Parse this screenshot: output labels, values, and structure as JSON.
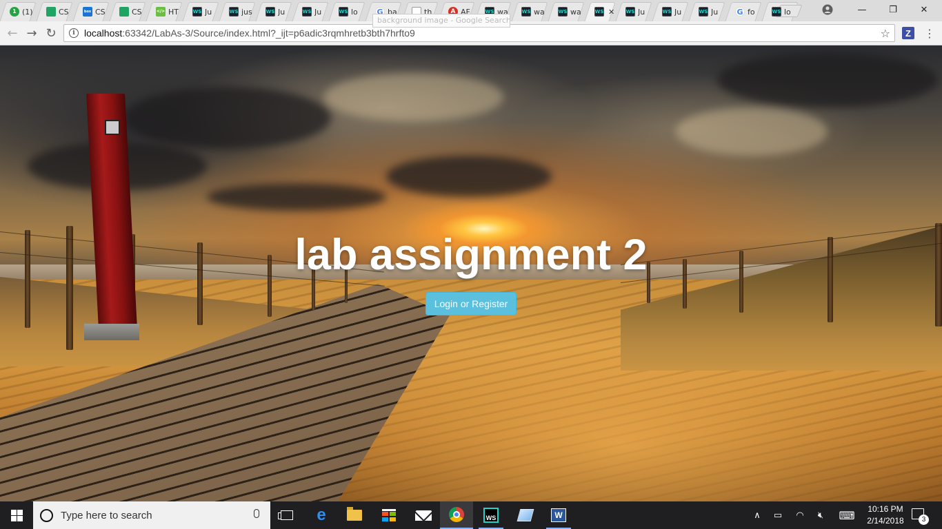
{
  "browser": {
    "tabs": [
      {
        "favicon": "circle-one-icon",
        "favicon_text": "1",
        "label": "(1)"
      },
      {
        "favicon": "sheets-icon",
        "favicon_text": "",
        "label": "CS"
      },
      {
        "favicon": "box-icon",
        "favicon_text": "box",
        "label": "CS"
      },
      {
        "favicon": "sheets-icon",
        "favicon_text": "",
        "label": "CS"
      },
      {
        "favicon": "html-icon",
        "favicon_text": "</>",
        "label": "HT"
      },
      {
        "favicon": "webstorm-icon",
        "favicon_text": "WS",
        "label": "Ju"
      },
      {
        "favicon": "webstorm-icon",
        "favicon_text": "WS",
        "label": "jus"
      },
      {
        "favicon": "webstorm-icon",
        "favicon_text": "WS",
        "label": "Ju"
      },
      {
        "favicon": "webstorm-icon",
        "favicon_text": "WS",
        "label": "Ju"
      },
      {
        "favicon": "webstorm-icon",
        "favicon_text": "WS",
        "label": "lo"
      },
      {
        "favicon": "google-icon",
        "favicon_text": "G",
        "label": "ba"
      },
      {
        "favicon": "document-icon",
        "favicon_text": "",
        "label": "th"
      },
      {
        "favicon": "ab-icon",
        "favicon_text": "A",
        "label": "AF"
      },
      {
        "favicon": "webstorm-icon",
        "favicon_text": "WS",
        "label": "wa"
      },
      {
        "favicon": "webstorm-icon",
        "favicon_text": "WS",
        "label": "wa"
      },
      {
        "favicon": "webstorm-icon",
        "favicon_text": "WS",
        "label": "wa"
      },
      {
        "favicon": "webstorm-icon",
        "favicon_text": "WS",
        "label": "",
        "active": true
      },
      {
        "favicon": "webstorm-icon",
        "favicon_text": "WS",
        "label": "Ju"
      },
      {
        "favicon": "webstorm-icon",
        "favicon_text": "WS",
        "label": "Ju"
      },
      {
        "favicon": "webstorm-icon",
        "favicon_text": "WS",
        "label": "Ju"
      },
      {
        "favicon": "google-icon",
        "favicon_text": "G",
        "label": "fo"
      },
      {
        "favicon": "webstorm-icon",
        "favicon_text": "WS",
        "label": "lo"
      }
    ],
    "tab_close_glyph": "✕",
    "tooltip": "background image - Google Search",
    "window_controls": {
      "minimize": "—",
      "maximize": "❐",
      "close": "✕"
    },
    "nav": {
      "back": "←",
      "forward": "→",
      "reload": "↻"
    },
    "address": {
      "host": "localhost",
      "rest": ":63342/LabAs-3/Source/index.html?_ijt=p6adic3rqmhretb3bth7hrfto9"
    },
    "bookmark_glyph": "☆",
    "extension_label": "Z",
    "menu_glyph": "⋮"
  },
  "page": {
    "title": "lab assignment 2",
    "button_label": "Login or Register",
    "accent": "#5bc0de"
  },
  "taskbar": {
    "search_placeholder": "Type here to search",
    "apps": [
      "task-view",
      "edge",
      "file-explorer",
      "store",
      "mail",
      "chrome",
      "webstorm",
      "sticky-notes",
      "word"
    ],
    "edge_glyph": "e",
    "webstorm_text": "WS",
    "word_text": "W",
    "tray": {
      "chevron": "∧",
      "battery": "▭",
      "wifi": "◠",
      "volume": "🔇︎",
      "keyboard": "⌨"
    },
    "time": "10:16 PM",
    "date": "2/14/2018",
    "notifications": "3"
  }
}
